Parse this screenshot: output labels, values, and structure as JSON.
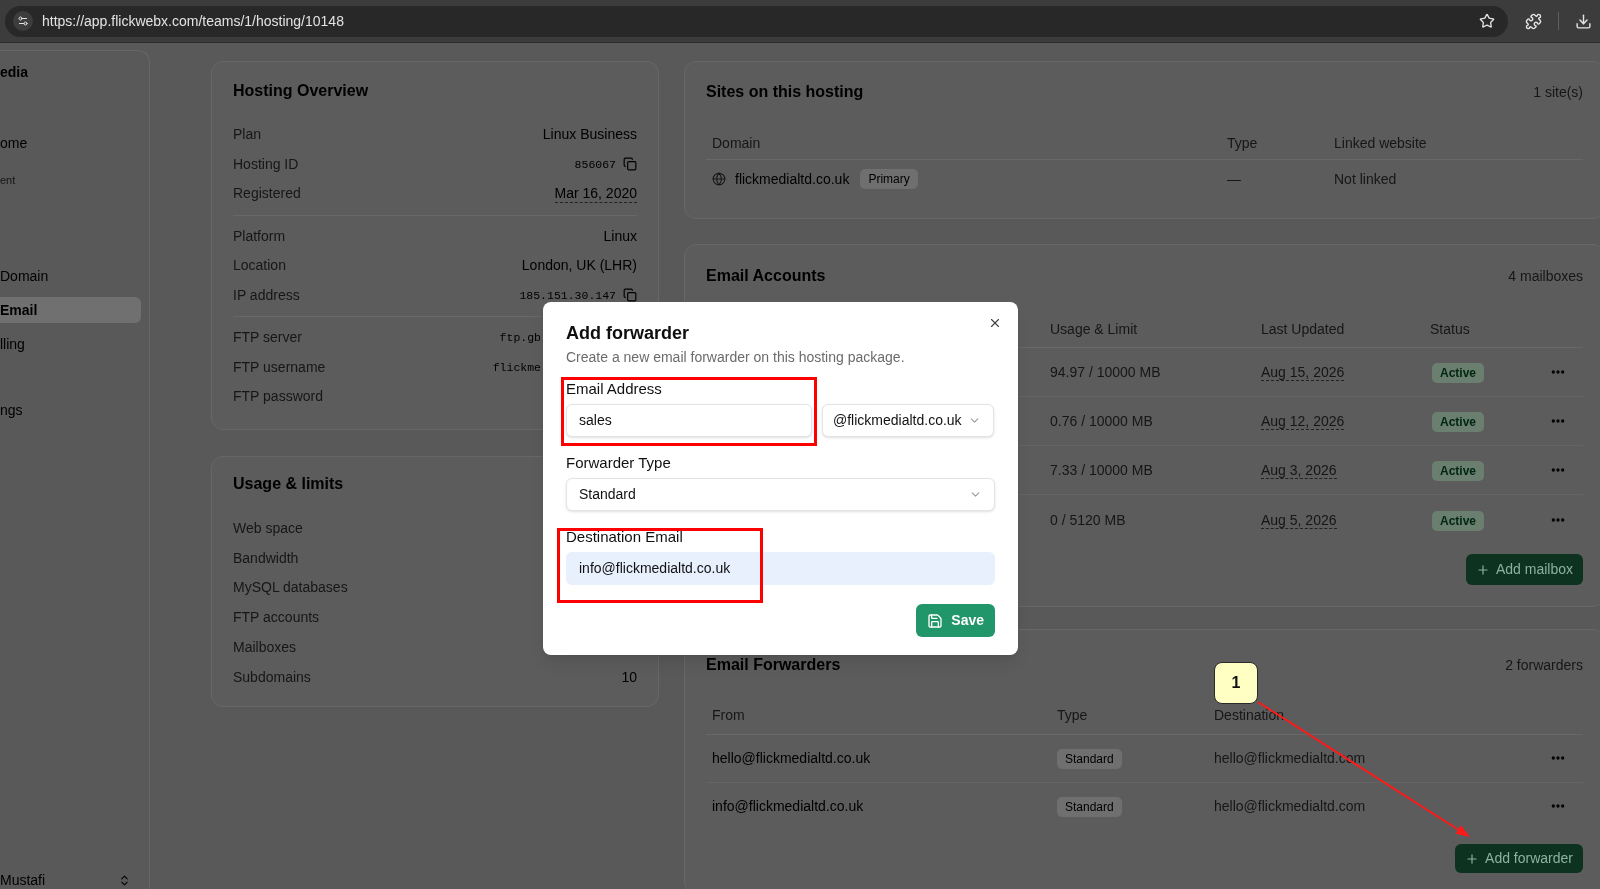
{
  "browser": {
    "url": "https://app.flickwebx.com/teams/1/hosting/10148"
  },
  "sidebar": {
    "workspace": "edia",
    "items": [
      {
        "label": "ome",
        "kind": "link",
        "selected": false
      },
      {
        "label": "ent",
        "kind": "section",
        "selected": false
      },
      {
        "label": "Domain",
        "kind": "link",
        "selected": false
      },
      {
        "label": "Email",
        "kind": "link",
        "selected": true
      },
      {
        "label": "lling",
        "kind": "link",
        "selected": false
      },
      {
        "label": "ngs",
        "kind": "link",
        "selected": false
      }
    ],
    "user": {
      "name": "Mustafi"
    }
  },
  "hosting_overview": {
    "title": "Hosting Overview",
    "groups": [
      [
        {
          "label": "Plan",
          "value": "Linux Business",
          "kind": "text"
        },
        {
          "label": "Hosting ID",
          "value": "856067",
          "kind": "mono_copy"
        },
        {
          "label": "Registered",
          "value": "Mar 16, 2020",
          "kind": "date"
        }
      ],
      [
        {
          "label": "Platform",
          "value": "Linux",
          "kind": "text"
        },
        {
          "label": "Location",
          "value": "London, UK (LHR)",
          "kind": "text"
        },
        {
          "label": "IP address",
          "value": "185.151.30.147",
          "kind": "mono_copy"
        }
      ],
      [
        {
          "label": "FTP server",
          "value": "ftp.gb",
          "kind": "mono"
        },
        {
          "label": "FTP username",
          "value": "flickme",
          "kind": "mono"
        },
        {
          "label": "FTP password"
        }
      ]
    ]
  },
  "usage_limits": {
    "title": "Usage & limits",
    "rows": [
      {
        "label": "Web space"
      },
      {
        "label": "Bandwidth"
      },
      {
        "label": "MySQL databases"
      },
      {
        "label": "FTP accounts"
      },
      {
        "label": "Mailboxes"
      },
      {
        "label": "Subdomains",
        "value": "10"
      }
    ]
  },
  "sites": {
    "title": "Sites on this hosting",
    "count": "1 site(s)",
    "columns": [
      "Domain",
      "Type",
      "Linked website"
    ],
    "rows": [
      {
        "domain": "flickmedialtd.co.uk",
        "badge": "Primary",
        "type": "—",
        "linked_website": "Not linked"
      }
    ]
  },
  "email_accounts": {
    "title": "Email Accounts",
    "count": "4 mailboxes",
    "columns": [
      "Usage & Limit",
      "Last Updated",
      "Status"
    ],
    "rows": [
      {
        "usage": "94.97 / 10000 MB",
        "last_updated": "Aug 15, 2026",
        "status": "Active"
      },
      {
        "usage": "0.76 / 10000 MB",
        "last_updated": "Aug 12, 2026",
        "status": "Active"
      },
      {
        "usage": "7.33 / 10000 MB",
        "last_updated": "Aug 3, 2026",
        "status": "Active"
      },
      {
        "usage": "0 / 5120 MB",
        "last_updated": "Aug 5, 2026",
        "status": "Active"
      }
    ],
    "add_button": "Add mailbox"
  },
  "email_forwarders": {
    "title": "Email Forwarders",
    "count": "2 forwarders",
    "columns": [
      "From",
      "Type",
      "Destination"
    ],
    "rows": [
      {
        "from": "hello@flickmedialtd.co.uk",
        "type": "Standard",
        "destination": "hello@flickmedialtd.com"
      },
      {
        "from": "info@flickmedialtd.co.uk",
        "type": "Standard",
        "destination": "hello@flickmedialtd.com"
      }
    ],
    "add_button": "Add forwarder"
  },
  "dialog": {
    "title": "Add forwarder",
    "description": "Create a new email forwarder on this hosting package.",
    "fields": [
      {
        "kind": "address",
        "label": "Email Address",
        "value": "sales",
        "domain": "@flickmedialtd.co.uk",
        "autofilled": false,
        "highlighted": true
      },
      {
        "kind": "select",
        "label": "Forwarder Type",
        "value": "Standard",
        "highlighted": false
      },
      {
        "kind": "input",
        "label": "Destination Email",
        "value": "info@flickmedialtd.co.uk",
        "autofilled": true,
        "highlighted": true
      }
    ],
    "save_button": "Save"
  },
  "annotation": {
    "callout": "1"
  }
}
